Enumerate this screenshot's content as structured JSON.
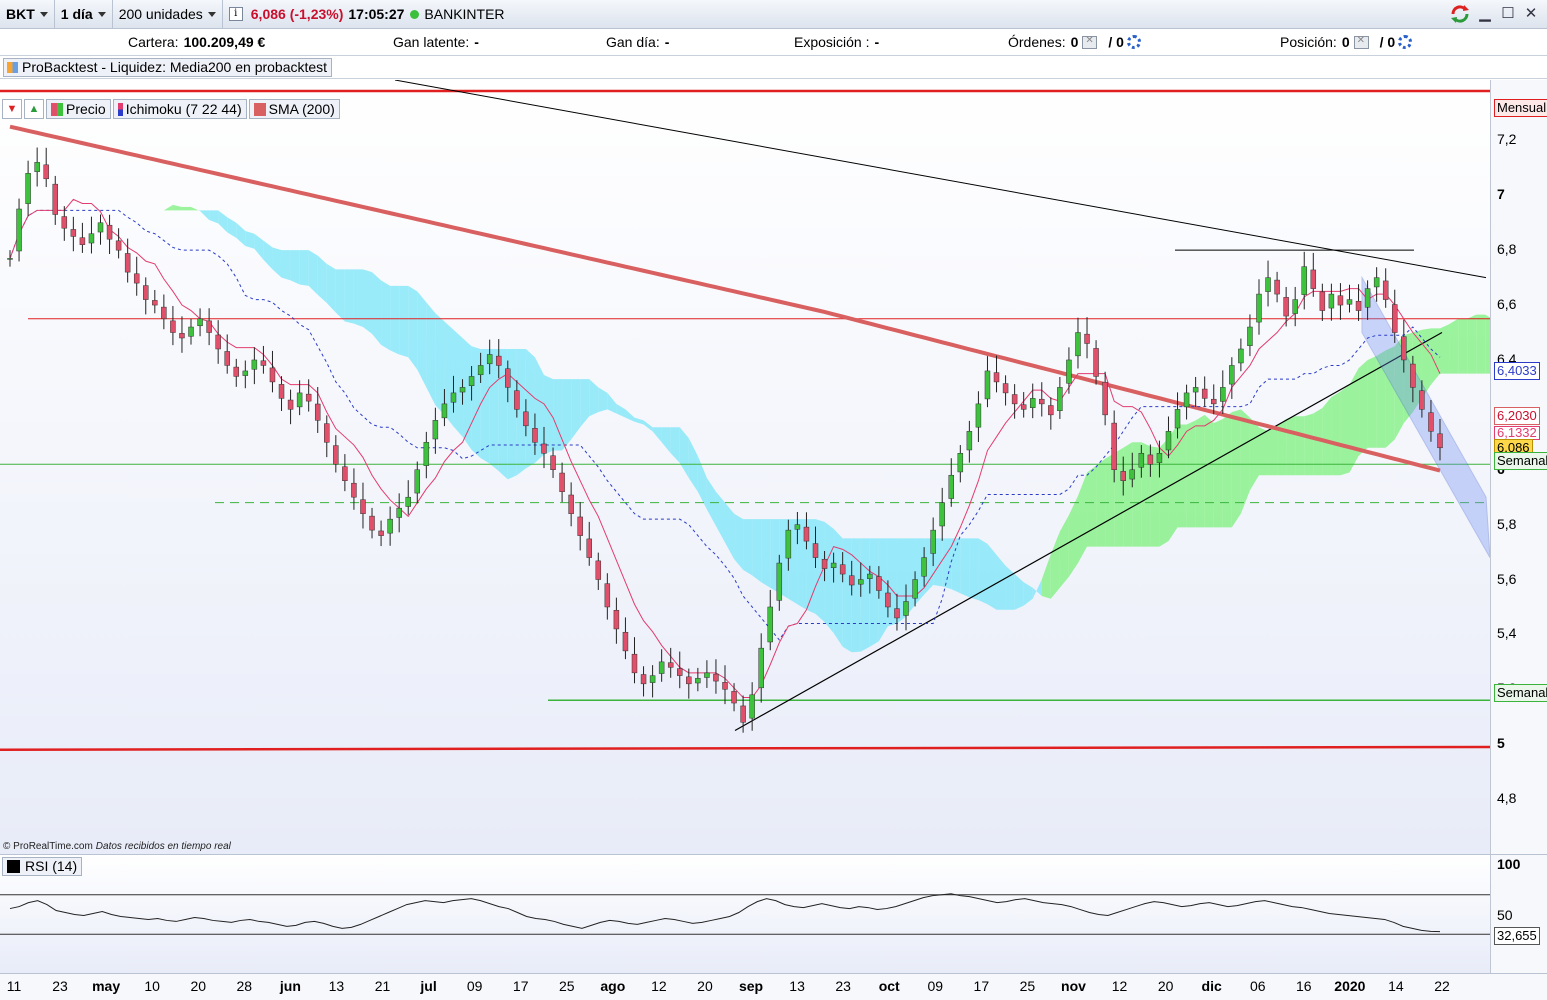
{
  "toolbar": {
    "symbol": "BKT",
    "interval": "1 día",
    "units": "200 unidades",
    "info_icon": "i",
    "price": "6,086 (-1,23%)",
    "time": "17:05:27",
    "name": "BANKINTER",
    "window_icons": [
      "refresh-icon",
      "minimize-icon",
      "maximize-icon",
      "close-icon"
    ]
  },
  "account": {
    "cartera_label": "Cartera:",
    "cartera_value": "100.209,49 €",
    "gan_latente_label": "Gan latente:",
    "gan_latente_value": "-",
    "gan_dia_label": "Gan día:",
    "gan_dia_value": "-",
    "exposicion_label": "Exposición :",
    "exposicion_value": "-",
    "ordenes_label": "Órdenes:",
    "ordenes_value": "0",
    "ordenes_value2": "/ 0",
    "posicion_label": "Posición:",
    "posicion_value": "0",
    "posicion_value2": "/ 0"
  },
  "strategy": "ProBacktest - Liquidez: Media200 en probacktest",
  "legend": {
    "precio": "Precio",
    "ichimoku": "Ichimoku (7 22 44)",
    "sma": "SMA (200)"
  },
  "markers": {
    "mensual": "Mensual",
    "ichimoku_top": "6,4033",
    "sma": "6,2030",
    "tenkan": "6,1332",
    "price": "6,086",
    "semanal_1": "Semanal",
    "semanal_2": "Semanal",
    "rsi_value": "32,655"
  },
  "colors": {
    "bull": "#3ec23e",
    "bear": "#e0506a",
    "sma": "#d96060",
    "tenkan": "#e33c6e",
    "kijun": "#2c3cc8",
    "cloud_bull": "#7cf07c",
    "cloud_bear": "#7ae6f8",
    "support_red": "#e02020",
    "support_green": "#3cb43c"
  },
  "watermark": {
    "brand": "© ProRealTime.com",
    "note": "Datos recibidos en tiempo real"
  },
  "rsi": {
    "label": "RSI (14)",
    "axis": [
      "100",
      "50"
    ]
  },
  "chart_data": {
    "type": "candlestick",
    "price_axis": {
      "ticks": [
        "7,2",
        "7",
        "6,8",
        "6,6",
        "6,4",
        "6,2",
        "6",
        "5,8",
        "5,6",
        "5,4",
        "5,2",
        "5",
        "4,8"
      ],
      "range": [
        4.6,
        7.42
      ]
    },
    "x_labels": [
      {
        "t": "11",
        "b": false
      },
      {
        "t": "23",
        "b": false
      },
      {
        "t": "may",
        "b": true
      },
      {
        "t": "10",
        "b": false
      },
      {
        "t": "20",
        "b": false
      },
      {
        "t": "28",
        "b": false
      },
      {
        "t": "jun",
        "b": true
      },
      {
        "t": "13",
        "b": false
      },
      {
        "t": "21",
        "b": false
      },
      {
        "t": "jul",
        "b": true
      },
      {
        "t": "09",
        "b": false
      },
      {
        "t": "17",
        "b": false
      },
      {
        "t": "25",
        "b": false
      },
      {
        "t": "ago",
        "b": true
      },
      {
        "t": "12",
        "b": false
      },
      {
        "t": "20",
        "b": false
      },
      {
        "t": "sep",
        "b": true
      },
      {
        "t": "13",
        "b": false
      },
      {
        "t": "23",
        "b": false
      },
      {
        "t": "oct",
        "b": true
      },
      {
        "t": "09",
        "b": false
      },
      {
        "t": "17",
        "b": false
      },
      {
        "t": "25",
        "b": false
      },
      {
        "t": "nov",
        "b": true
      },
      {
        "t": "12",
        "b": false
      },
      {
        "t": "20",
        "b": false
      },
      {
        "t": "dic",
        "b": true
      },
      {
        "t": "06",
        "b": false
      },
      {
        "t": "16",
        "b": false
      },
      {
        "t": "2020",
        "b": true
      },
      {
        "t": "14",
        "b": false
      },
      {
        "t": "22",
        "b": false
      }
    ],
    "close": [
      6.77,
      6.95,
      7.08,
      7.12,
      7.06,
      6.93,
      6.88,
      6.85,
      6.82,
      6.86,
      6.9,
      6.84,
      6.8,
      6.72,
      6.68,
      6.62,
      6.6,
      6.55,
      6.5,
      6.48,
      6.52,
      6.55,
      6.5,
      6.44,
      6.38,
      6.34,
      6.36,
      6.4,
      6.38,
      6.32,
      6.26,
      6.22,
      6.28,
      6.25,
      6.18,
      6.1,
      6.02,
      5.96,
      5.9,
      5.84,
      5.78,
      5.76,
      5.82,
      5.86,
      5.9,
      6.0,
      6.1,
      6.18,
      6.24,
      6.28,
      6.3,
      6.34,
      6.38,
      6.42,
      6.38,
      6.3,
      6.22,
      6.16,
      6.1,
      6.06,
      6.0,
      5.92,
      5.84,
      5.76,
      5.68,
      5.6,
      5.5,
      5.42,
      5.34,
      5.26,
      5.22,
      5.25,
      5.3,
      5.28,
      5.25,
      5.22,
      5.24,
      5.26,
      5.23,
      5.2,
      5.15,
      5.08,
      5.18,
      5.35,
      5.5,
      5.66,
      5.78,
      5.8,
      5.74,
      5.68,
      5.64,
      5.66,
      5.62,
      5.58,
      5.6,
      5.62,
      5.56,
      5.5,
      5.46,
      5.52,
      5.6,
      5.68,
      5.78,
      5.88,
      5.98,
      6.06,
      6.14,
      6.24,
      6.36,
      6.32,
      6.28,
      6.24,
      6.22,
      6.26,
      6.24,
      6.2,
      6.3,
      6.4,
      6.5,
      6.46,
      6.34,
      6.2,
      6.0,
      5.96,
      6.0,
      6.06,
      6.02,
      6.06,
      6.14,
      6.22,
      6.28,
      6.3,
      6.26,
      6.24,
      6.3,
      6.38,
      6.44,
      6.52,
      6.64,
      6.7,
      6.64,
      6.56,
      6.62,
      6.74,
      6.66,
      6.58,
      6.64,
      6.6,
      6.62,
      6.58,
      6.66,
      6.7,
      6.62,
      6.5,
      6.4,
      6.3,
      6.22,
      6.14,
      6.08
    ],
    "rsi": [
      56,
      58,
      62,
      64,
      60,
      54,
      52,
      50,
      49,
      51,
      53,
      50,
      48,
      47,
      46,
      45,
      46,
      44,
      43,
      45,
      47,
      46,
      44,
      43,
      42,
      44,
      45,
      43,
      42,
      40,
      38,
      39,
      42,
      43,
      41,
      38,
      36,
      37,
      40,
      44,
      48,
      52,
      56,
      60,
      62,
      64,
      63,
      62,
      64,
      65,
      66,
      64,
      61,
      58,
      56,
      52,
      48,
      46,
      45,
      43,
      40,
      38,
      36,
      39,
      42,
      44,
      43,
      41,
      40,
      42,
      44,
      46,
      45,
      43,
      41,
      42,
      44,
      46,
      48,
      52,
      58,
      63,
      66,
      64,
      60,
      58,
      57,
      59,
      61,
      59,
      57,
      56,
      58,
      57,
      55,
      56,
      58,
      61,
      64,
      67,
      69,
      70,
      71,
      69,
      68,
      66,
      64,
      62,
      63,
      65,
      66,
      64,
      62,
      61,
      60,
      58,
      55,
      52,
      50,
      49,
      52,
      55,
      58,
      61,
      63,
      62,
      60,
      58,
      59,
      61,
      62,
      60,
      58,
      59,
      61,
      63,
      64,
      62,
      60,
      58,
      57,
      55,
      53,
      51,
      50,
      49,
      48,
      47,
      46,
      45,
      42,
      38,
      36,
      34,
      33,
      32.655
    ]
  }
}
